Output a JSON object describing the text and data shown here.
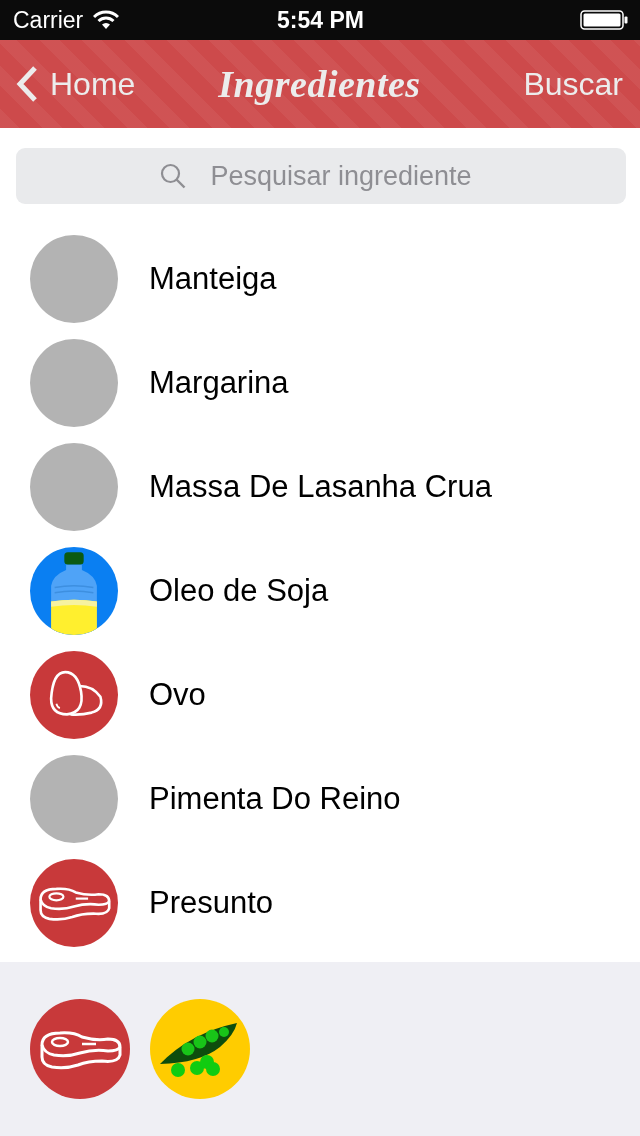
{
  "status_bar": {
    "carrier": "Carrier",
    "time": "5:54 PM"
  },
  "nav_bar": {
    "back": "Home",
    "title": "Ingredientes",
    "action": "Buscar"
  },
  "search": {
    "placeholder": "Pesquisar ingrediente"
  },
  "ingredients": [
    {
      "name": "Manteiga",
      "kind": "placeholder"
    },
    {
      "name": "Margarina",
      "kind": "placeholder"
    },
    {
      "name": "Massa De Lasanha Crua",
      "kind": "placeholder"
    },
    {
      "name": "Oleo de Soja",
      "kind": "bottle"
    },
    {
      "name": "Ovo",
      "kind": "egg"
    },
    {
      "name": "Pimenta Do Reino",
      "kind": "placeholder"
    },
    {
      "name": "Presunto",
      "kind": "meat"
    }
  ],
  "selected_tray": [
    {
      "kind": "meat"
    },
    {
      "kind": "peas"
    }
  ]
}
